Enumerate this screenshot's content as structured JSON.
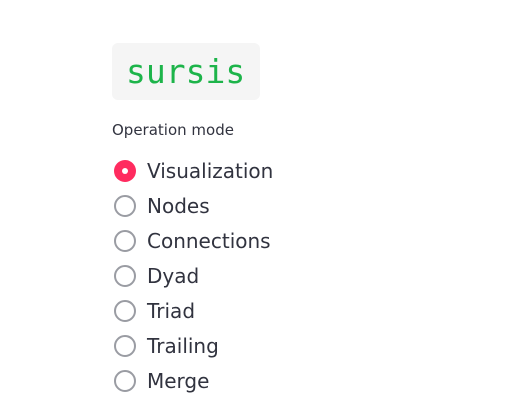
{
  "logo": {
    "text": "sursis",
    "color": "#1db44a"
  },
  "operation_mode": {
    "label": "Operation mode",
    "selected": "Visualization",
    "accent_color": "#ff2b5f",
    "options": [
      {
        "label": "Visualization",
        "selected": true
      },
      {
        "label": "Nodes",
        "selected": false
      },
      {
        "label": "Connections",
        "selected": false
      },
      {
        "label": "Dyad",
        "selected": false
      },
      {
        "label": "Triad",
        "selected": false
      },
      {
        "label": "Trailing",
        "selected": false
      },
      {
        "label": "Merge",
        "selected": false
      }
    ]
  }
}
